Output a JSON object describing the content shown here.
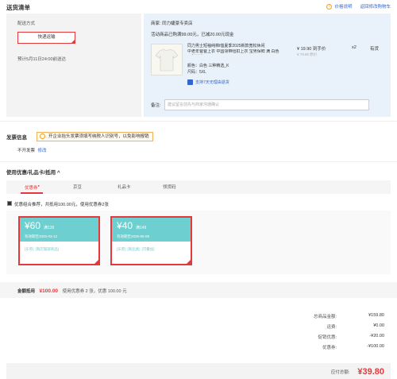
{
  "header": {
    "title": "送货清单",
    "price_note": "价格说明",
    "back_to_cart": "返回修改购物车"
  },
  "shipping": {
    "method_label": "配送方式",
    "method_value": "快递运输",
    "eta": "预计5月11日24:00前送达"
  },
  "seller": {
    "label": "商家:",
    "name": "同力婕豪专卖店",
    "promo": "活动商品已购满99.00元，已减20.00元现金"
  },
  "product": {
    "title_line1": "同力男士短袖纯棉t恤夏季2025新款宽松休闲",
    "title_line2": "中老年爸爸上衣 中国领带纽扣上衣 宝男保鲜 满 白色 三种精选_K",
    "color": "颜色：白色 三种精选_K",
    "size": "尺码：5XL",
    "price": "¥ 19.90 到手价",
    "orig_price": "¥ 79.90 原价",
    "qty": "x2",
    "stock": "有货",
    "return_policy": "支持7天无理由退货"
  },
  "note": {
    "label": "备注:",
    "placeholder": "建议留言前先与商家沟通确认"
  },
  "invoice": {
    "label": "发票信息",
    "tip": "开企业抬头发票须填写纳税人识别号，以免影响报销",
    "type": "不开发票",
    "edit": "修改"
  },
  "discount": {
    "title": "使用优惠/礼品卡/抵用 ^",
    "tabs": [
      "优惠券",
      "京豆",
      "礼品卡",
      "领货码"
    ],
    "optimal_text": "优惠组合推荐，共抵用100.00元，使用优惠券2张"
  },
  "coupons": [
    {
      "amount": "¥60",
      "condition": "满139",
      "date": "有效期至2025-03-12",
      "tags": [
        "[东券]",
        "[限店铺部商品]"
      ]
    },
    {
      "amount": "¥40",
      "condition": "满149",
      "date": "有效期至2025-05-09",
      "tags": [
        "[东券]",
        "[限品类]",
        "[可叠加]"
      ]
    }
  ],
  "coupon_summary": {
    "label": "金额抵用",
    "amount": "¥100.00",
    "detail": "使用优惠券 2 张，优惠 100.00 元"
  },
  "totals": [
    {
      "label": "总商品金额:",
      "value": "¥159.80"
    },
    {
      "label": "运费:",
      "value": "¥0.00"
    },
    {
      "label": "促销优惠:",
      "value": "-¥20.00"
    },
    {
      "label": "优惠券:",
      "value": "-¥100.00"
    }
  ],
  "payable": {
    "label": "应付总额:",
    "value": "¥39.80"
  },
  "colors": {
    "accent": "#e4393c",
    "coupon": "#6dcfcf",
    "link": "#3366cc"
  }
}
